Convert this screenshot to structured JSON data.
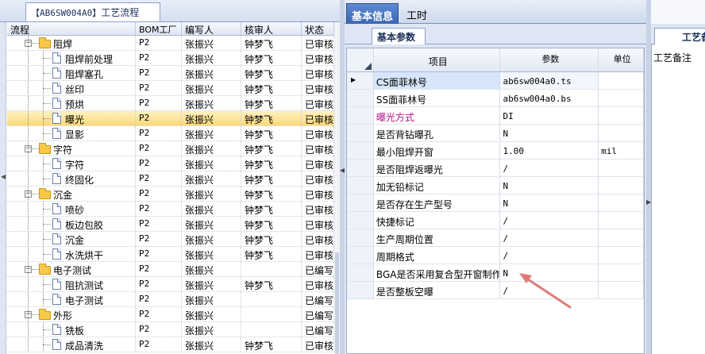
{
  "left_tab": {
    "code": "【AB6SW004A0】",
    "title": "工艺流程"
  },
  "grid_headers": [
    "流程",
    "BOM工厂",
    "编写人",
    "核审人",
    "状态"
  ],
  "rows": [
    {
      "level": 0,
      "type": "folder",
      "name": "阻焊",
      "bom": "P2",
      "writer": "张振兴",
      "reviewer": "钟梦飞",
      "status": "已审核"
    },
    {
      "level": 1,
      "type": "doc",
      "name": "阻焊前处理",
      "bom": "P2",
      "writer": "张振兴",
      "reviewer": "钟梦飞",
      "status": "已审核"
    },
    {
      "level": 1,
      "type": "doc",
      "name": "阻焊塞孔",
      "bom": "P2",
      "writer": "张振兴",
      "reviewer": "钟梦飞",
      "status": "已审核"
    },
    {
      "level": 1,
      "type": "doc",
      "name": "丝印",
      "bom": "P2",
      "writer": "张振兴",
      "reviewer": "钟梦飞",
      "status": "已审核"
    },
    {
      "level": 1,
      "type": "doc",
      "name": "预烘",
      "bom": "P2",
      "writer": "张振兴",
      "reviewer": "钟梦飞",
      "status": "已审核"
    },
    {
      "level": 1,
      "type": "doc",
      "name": "曝光",
      "bom": "P2",
      "writer": "张振兴",
      "reviewer": "钟梦飞",
      "status": "已审核",
      "selected": true
    },
    {
      "level": 1,
      "type": "doc",
      "name": "显影",
      "bom": "P2",
      "writer": "张振兴",
      "reviewer": "钟梦飞",
      "status": "已审核"
    },
    {
      "level": 0,
      "type": "folder",
      "name": "字符",
      "bom": "P2",
      "writer": "张振兴",
      "reviewer": "钟梦飞",
      "status": "已审核"
    },
    {
      "level": 1,
      "type": "doc",
      "name": "字符",
      "bom": "P2",
      "writer": "张振兴",
      "reviewer": "钟梦飞",
      "status": "已审核"
    },
    {
      "level": 1,
      "type": "doc",
      "name": "终固化",
      "bom": "P2",
      "writer": "张振兴",
      "reviewer": "钟梦飞",
      "status": "已审核"
    },
    {
      "level": 0,
      "type": "folder",
      "name": "沉金",
      "bom": "P2",
      "writer": "张振兴",
      "reviewer": "钟梦飞",
      "status": "已审核"
    },
    {
      "level": 1,
      "type": "doc",
      "name": "喷砂",
      "bom": "P2",
      "writer": "张振兴",
      "reviewer": "钟梦飞",
      "status": "已审核"
    },
    {
      "level": 1,
      "type": "doc",
      "name": "板边包胶",
      "bom": "P2",
      "writer": "张振兴",
      "reviewer": "钟梦飞",
      "status": "已审核"
    },
    {
      "level": 1,
      "type": "doc",
      "name": "沉金",
      "bom": "P2",
      "writer": "张振兴",
      "reviewer": "钟梦飞",
      "status": "已审核"
    },
    {
      "level": 1,
      "type": "doc",
      "name": "水洗烘干",
      "bom": "P2",
      "writer": "张振兴",
      "reviewer": "钟梦飞",
      "status": "已审核"
    },
    {
      "level": 0,
      "type": "folder",
      "name": "电子测试",
      "bom": "P2",
      "writer": "张振兴",
      "reviewer": "",
      "status": "已编写"
    },
    {
      "level": 1,
      "type": "doc",
      "name": "阻抗测试",
      "bom": "P2",
      "writer": "张振兴",
      "reviewer": "钟梦飞",
      "status": "已审核"
    },
    {
      "level": 1,
      "type": "doc",
      "name": "电子测试",
      "bom": "P2",
      "writer": "张振兴",
      "reviewer": "",
      "status": "已编写"
    },
    {
      "level": 0,
      "type": "folder",
      "name": "外形",
      "bom": "P2",
      "writer": "张振兴",
      "reviewer": "",
      "status": "已编写"
    },
    {
      "level": 1,
      "type": "doc",
      "name": "铣板",
      "bom": "P2",
      "writer": "张振兴",
      "reviewer": "",
      "status": "已编写"
    },
    {
      "level": 1,
      "type": "doc",
      "name": "成品清洗",
      "bom": "P2",
      "writer": "张振兴",
      "reviewer": "钟梦飞",
      "status": "已审核"
    }
  ],
  "main_tabs": [
    "基本信息",
    "工时"
  ],
  "sub_tab": "基本参数",
  "param_headers": [
    "项目",
    "参数",
    "单位"
  ],
  "params": [
    {
      "name": "CS面菲林号",
      "value": "ab6sw004a0.ts",
      "unit": "",
      "current": true
    },
    {
      "name": "SS面菲林号",
      "value": "ab6sw004a0.bs",
      "unit": ""
    },
    {
      "name": "曝光方式",
      "value": "DI",
      "unit": "",
      "magenta": true
    },
    {
      "name": "是否背钻曝孔",
      "value": "N",
      "unit": ""
    },
    {
      "name": "最小阻焊开窗",
      "value": "1.00",
      "unit": "mil"
    },
    {
      "name": "是否阻焊返曝光",
      "value": "/",
      "unit": ""
    },
    {
      "name": "加无铅标记",
      "value": "N",
      "unit": ""
    },
    {
      "name": "是否存在生产型号",
      "value": "N",
      "unit": ""
    },
    {
      "name": "快捷标记",
      "value": "/",
      "unit": ""
    },
    {
      "name": "生产周期位置",
      "value": "/",
      "unit": ""
    },
    {
      "name": "周期格式",
      "value": "/",
      "unit": ""
    },
    {
      "name": "BGA是否采用复合型开窗制作",
      "value": "N",
      "unit": ""
    },
    {
      "name": "是否整板空曝",
      "value": "/",
      "unit": ""
    }
  ],
  "right_tab": "工艺备注",
  "right_label": "工艺备注",
  "colors": {
    "accent": "#3b66b3",
    "selected_row": "#fbd977",
    "arrow": "#e07a7a",
    "magenta": "#b0148c"
  }
}
